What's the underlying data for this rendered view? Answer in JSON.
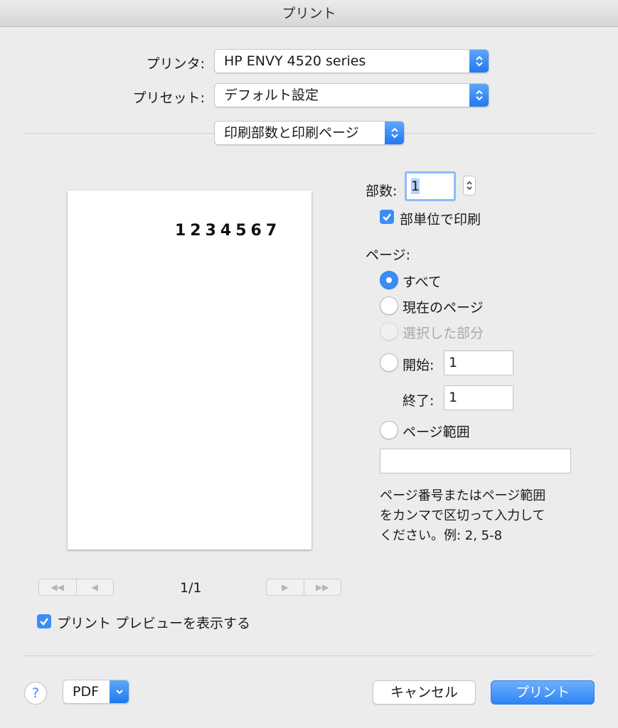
{
  "window": {
    "title": "プリント"
  },
  "printer": {
    "label": "プリンタ:",
    "value": "HP ENVY 4520 series"
  },
  "preset": {
    "label": "プリセット:",
    "value": "デフォルト設定"
  },
  "section": {
    "value": "印刷部数と印刷ページ"
  },
  "preview": {
    "content": "1234567",
    "page_indicator": "1/1"
  },
  "copies": {
    "label": "部数:",
    "value": "1",
    "collate_label": "部単位で印刷",
    "collate_checked": true
  },
  "pages": {
    "label": "ページ:",
    "all_label": "すべて",
    "current_label": "現在のページ",
    "selection_label": "選択した部分",
    "from_label": "開始:",
    "from_value": "1",
    "to_label": "終了:",
    "to_value": "1",
    "range_label": "ページ範囲",
    "range_value": "",
    "hint_line1": "ページ番号またはページ範囲",
    "hint_line2": "をカンマで区切って入力して",
    "hint_line3": "ください。例: 2, 5-8"
  },
  "show_preview_label": "プリント プレビューを表示する",
  "footer": {
    "help": "?",
    "pdf_label": "PDF",
    "cancel_label": "キャンセル",
    "print_label": "プリント"
  },
  "colors": {
    "accent": "#3b8df6",
    "background": "#ececec"
  }
}
